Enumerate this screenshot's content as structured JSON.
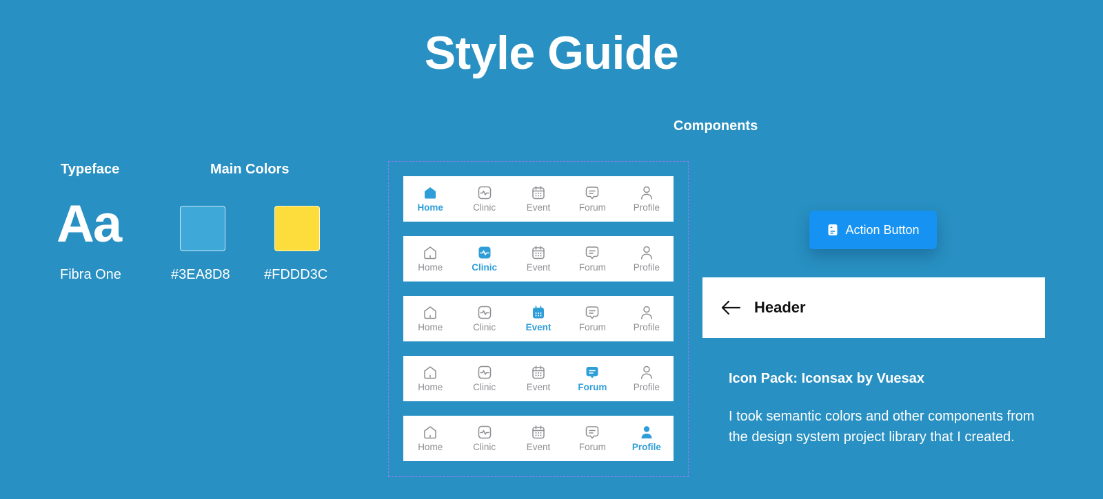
{
  "title": "Style Guide",
  "typeface": {
    "heading": "Typeface",
    "sample": "Aa",
    "name": "Fibra One"
  },
  "main_colors": {
    "heading": "Main Colors",
    "swatches": [
      {
        "label": "#3EA8D8",
        "color": "#3EA8D8"
      },
      {
        "label": "#FDDD3C",
        "color": "#FDDD3C"
      }
    ]
  },
  "components": {
    "heading": "Components",
    "nav_items": [
      {
        "label": "Home",
        "icon": "home-icon"
      },
      {
        "label": "Clinic",
        "icon": "clinic-icon"
      },
      {
        "label": "Event",
        "icon": "calendar-icon"
      },
      {
        "label": "Forum",
        "icon": "chat-icon"
      },
      {
        "label": "Profile",
        "icon": "profile-icon"
      }
    ],
    "nav_active_indices": [
      0,
      1,
      2,
      3,
      4
    ],
    "action_button_label": "Action Button",
    "header_label": "Header"
  },
  "icon_pack": "Icon Pack: Iconsax by Vuesax",
  "description": "I took semantic colors and other components from the design system project library that I created.",
  "colors": {
    "background": "#2890C2",
    "active_nav": "#2F9ED8",
    "inactive_nav": "#8E8E93",
    "action_button": "#1592F2",
    "frame_dash": "#8F7DF2"
  }
}
